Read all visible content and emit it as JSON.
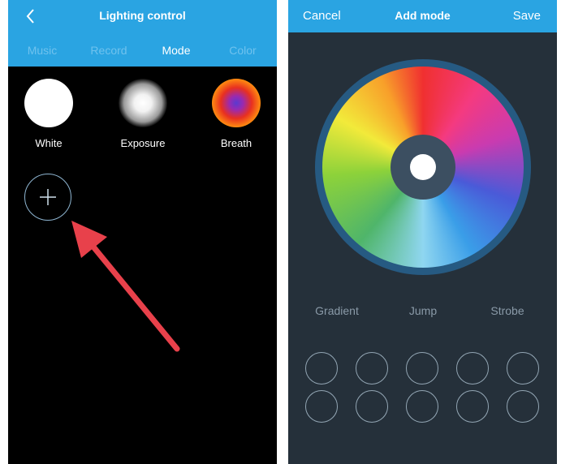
{
  "left_screen": {
    "title": "Lighting control",
    "back_icon": "chevron-left-icon",
    "tabs": [
      {
        "label": "Music",
        "active": false
      },
      {
        "label": "Record",
        "active": false
      },
      {
        "label": "Mode",
        "active": true
      },
      {
        "label": "Color",
        "active": false
      }
    ],
    "modes": [
      {
        "label": "White"
      },
      {
        "label": "Exposure"
      },
      {
        "label": "Breath"
      }
    ],
    "add_icon": "plus-icon",
    "annotation_icon": "red-arrow-icon"
  },
  "right_screen": {
    "cancel_label": "Cancel",
    "title": "Add mode",
    "save_label": "Save",
    "effects": [
      {
        "label": "Gradient"
      },
      {
        "label": "Jump"
      },
      {
        "label": "Strobe"
      }
    ]
  },
  "colors": {
    "header_blue": "#2aa4e2",
    "tab_inactive": "#6fc2ee",
    "right_background": "#25303a",
    "wheel_ring": "#265a82",
    "arrow_red": "#e8414b"
  }
}
